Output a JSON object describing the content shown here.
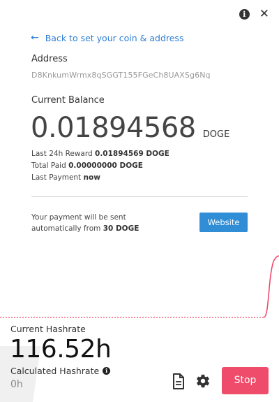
{
  "header": {
    "info_icon": "info-icon",
    "close_icon": "close-icon"
  },
  "back_link": {
    "label": "Back to set your coin & address",
    "icon": "arrow-left-icon"
  },
  "address": {
    "label": "Address",
    "value": "D8KnkumWrmx8qSGGT155FGeCh8UAXSg6Nq"
  },
  "balance": {
    "label": "Current Balance",
    "amount": "0.01894568",
    "unit": "DOGE"
  },
  "stats": {
    "reward_label": "Last 24h Reward",
    "reward_value": "0.01894569 DOGE",
    "paid_label": "Total Paid",
    "paid_value": "0.00000000 DOGE",
    "last_payment_label": "Last Payment",
    "last_payment_value": "now"
  },
  "payment": {
    "note_prefix": "Your payment will be sent automatically from",
    "threshold": "30 DOGE",
    "website_label": "Website"
  },
  "graph": {
    "line_color": "#ef4b6a",
    "baseline_color": "#ef4b6a"
  },
  "footer": {
    "hashrate_label": "Current Hashrate",
    "hashrate_value": "116.52h",
    "calc_label": "Calculated Hashrate",
    "calc_value": "0h",
    "log_icon": "document-icon",
    "settings_icon": "gear-icon",
    "stop_label": "Stop"
  }
}
